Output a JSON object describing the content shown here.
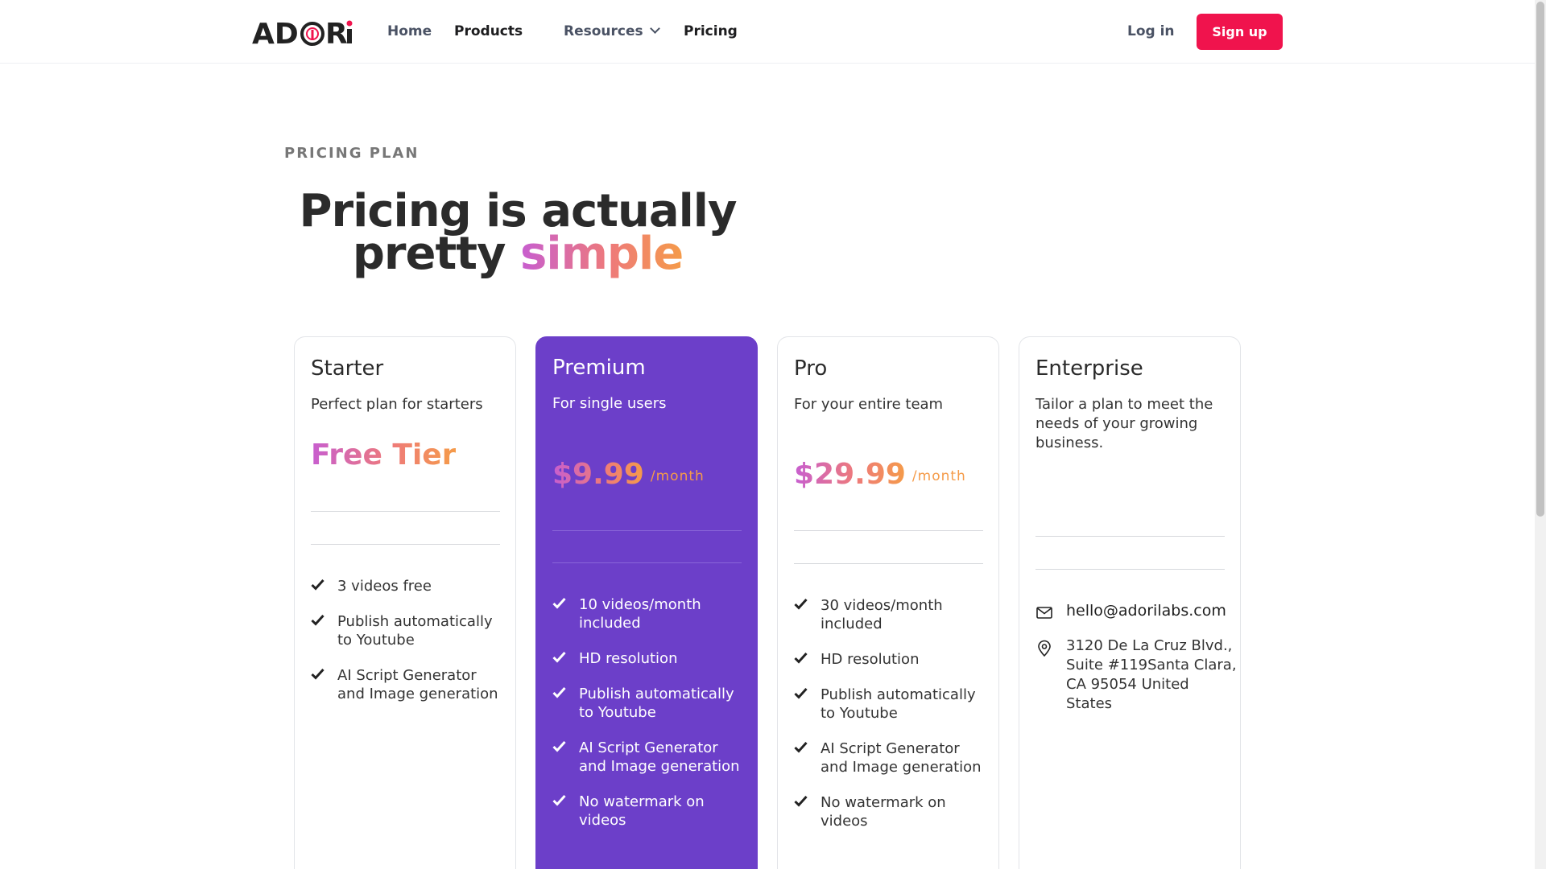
{
  "nav": {
    "logo": "ADORi",
    "links": [
      "Home",
      "Products",
      "Resources",
      "Pricing"
    ],
    "login": "Log in",
    "signup": "Sign up"
  },
  "hero": {
    "eyebrow": "PRICING PLAN",
    "headline_1": "Pricing is actually",
    "headline_2": "pretty",
    "headline_accent": "simple"
  },
  "plans": [
    {
      "name": "Starter",
      "tagline": "Perfect plan for starters",
      "price": "Free Tier",
      "features": [
        "3 videos free",
        "Publish automatically to Youtube",
        "AI Script Generator and Image generation"
      ]
    },
    {
      "name": "Premium",
      "tagline": "For single users",
      "price": "$9.99",
      "period": "/month",
      "features": [
        "10 videos/month included",
        "HD resolution",
        "Publish automatically to Youtube",
        "AI Script Generator and Image generation",
        "No watermark on videos"
      ]
    },
    {
      "name": "Pro",
      "tagline": "For your entire team",
      "price": "$29.99",
      "period": "/month",
      "features": [
        "30 videos/month included",
        "HD resolution",
        "Publish automatically to Youtube",
        "AI Script Generator and Image generation",
        "No watermark on videos"
      ]
    },
    {
      "name": "Enterprise",
      "tagline": "Tailor a plan to meet the needs of your growing business.",
      "email": "hello@adorilabs.com",
      "address": "3120 De La Cruz Blvd., Suite #119Santa Clara, CA 95054 United States"
    }
  ],
  "colors": {
    "brand_red": "#f0134d",
    "featured_purple": "#6c3fc9",
    "gradient_start": "#c75ed0",
    "gradient_end": "#f59b49"
  }
}
